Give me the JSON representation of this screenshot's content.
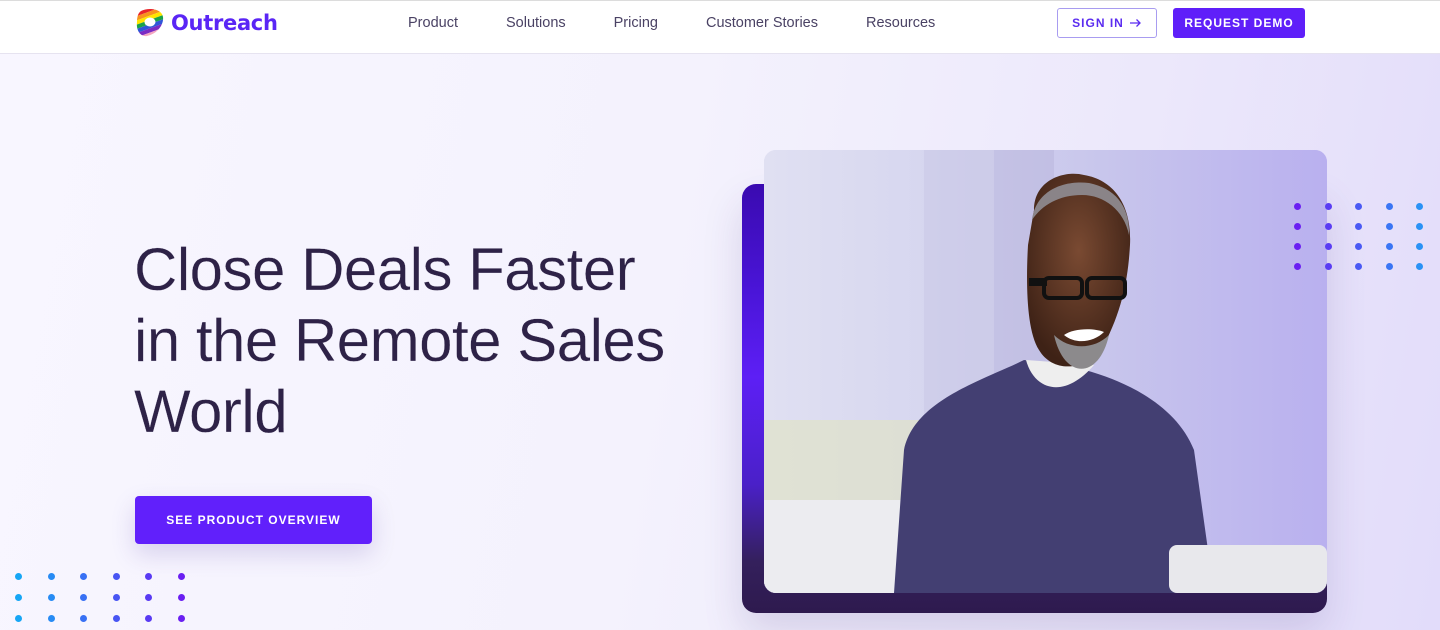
{
  "header": {
    "brand": "Outreach",
    "nav": [
      "Product",
      "Solutions",
      "Pricing",
      "Customer Stories",
      "Resources"
    ],
    "sign_in_label": "SIGN IN",
    "sign_in_icon": "arrow-right-icon",
    "request_demo_label": "REQUEST DEMO"
  },
  "hero": {
    "headline_lines": [
      "Close Deals Faster",
      "in the Remote Sales",
      "World"
    ],
    "cta_label": "SEE PRODUCT OVERVIEW",
    "image_alt": "Smiling man with glasses in a purple sweater at a laptop"
  },
  "colors": {
    "brand_purple": "#5f1ff9",
    "headline": "#2e2247",
    "nav_text": "#4a4264"
  }
}
